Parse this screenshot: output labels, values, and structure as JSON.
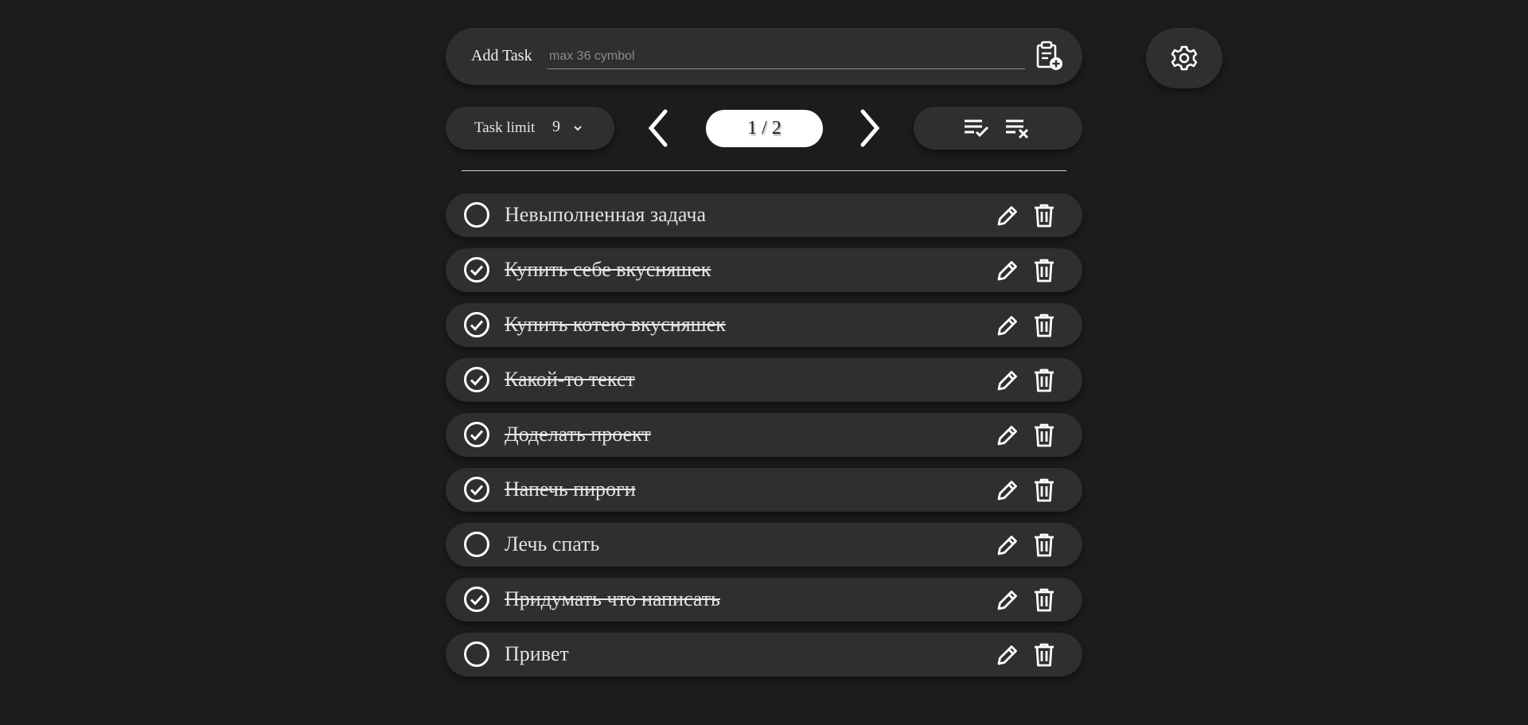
{
  "add_task": {
    "label": "Add Task",
    "placeholder": "max 36 cymbol",
    "value": "",
    "icon": "clipboard-add-icon"
  },
  "settings": {
    "icon": "gear-icon"
  },
  "task_limit": {
    "label": "Task limit",
    "value": "9",
    "icon": "chevron-down-icon"
  },
  "pager": {
    "prev_icon": "chevron-left-icon",
    "next_icon": "chevron-right-icon",
    "label": "1 / 2"
  },
  "bulk_actions": [
    {
      "name": "complete-all",
      "icon": "list-check-icon"
    },
    {
      "name": "clear-all",
      "icon": "list-remove-icon"
    }
  ],
  "tasks": [
    {
      "text": "Невыполненная задача",
      "done": false
    },
    {
      "text": "Купить себе вкусняшек",
      "done": true
    },
    {
      "text": "Купить котею вкусняшек",
      "done": true
    },
    {
      "text": "Какой-то текст",
      "done": true
    },
    {
      "text": "Доделать проект",
      "done": true
    },
    {
      "text": "Напечь пироги",
      "done": true
    },
    {
      "text": "Лечь спать",
      "done": false
    },
    {
      "text": "Придумать что написать",
      "done": true
    },
    {
      "text": "Привет",
      "done": false
    }
  ],
  "colors": {
    "background": "#1c1c1e",
    "surface": "#2f2f31",
    "text": "#e2e2e2",
    "page_indicator_bg": "#ffffff"
  }
}
